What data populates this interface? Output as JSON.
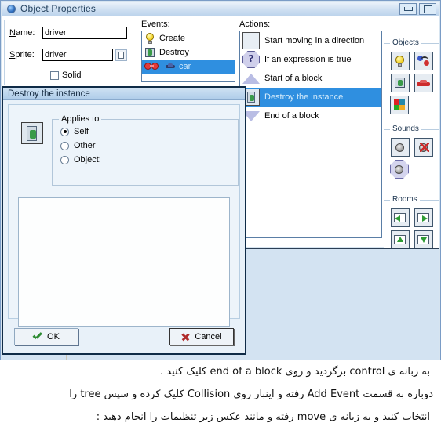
{
  "window": {
    "title": "Object Properties",
    "icon": "app-icon",
    "buttons": [
      {
        "name": "minimize-button",
        "glyph": "minimize-icon"
      },
      {
        "name": "maximize-button",
        "glyph": "maximize-icon"
      }
    ]
  },
  "properties": {
    "name_label": "Name:",
    "name_value": "driver",
    "sprite_label": "Sprite:",
    "sprite_value": "driver",
    "sprite_picker": "sprite-menu-icon",
    "solid_label": "Solid",
    "solid_checked": false
  },
  "events": {
    "caption": "Events:",
    "items": [
      {
        "label": "Create",
        "icon": "lightbulb-icon",
        "selected": false
      },
      {
        "label": "Destroy",
        "icon": "shield-icon",
        "selected": false
      },
      {
        "label": "car",
        "icon": "collision-icon",
        "selected": true
      }
    ]
  },
  "actions": {
    "caption": "Actions:",
    "items": [
      {
        "label": "Start moving in a direction",
        "icon": "move-direction-icon",
        "selected": false
      },
      {
        "label": "If an expression is true",
        "icon": "question-icon",
        "selected": false
      },
      {
        "label": "Start of a block",
        "icon": "block-start-icon",
        "selected": false
      },
      {
        "label": "Destroy the instance",
        "icon": "destroy-instance-icon",
        "selected": true
      },
      {
        "label": "End of a block",
        "icon": "block-end-icon",
        "selected": false
      }
    ]
  },
  "toolbar": {
    "groups": [
      {
        "caption": "Objects",
        "buttons": [
          {
            "name": "create-event-button",
            "icon": "lightbulb-icon"
          },
          {
            "name": "add-object-event-button",
            "icon": "objects-icon"
          },
          {
            "name": "destroy-event-button",
            "icon": "shield-icon"
          },
          {
            "name": "car-object-button",
            "icon": "car-icon"
          },
          {
            "name": "draw-event-button",
            "icon": "palette-icon"
          }
        ]
      },
      {
        "caption": "Sounds",
        "buttons": [
          {
            "name": "play-sound-button",
            "icon": "speaker-icon"
          },
          {
            "name": "stop-sound-button",
            "icon": "speaker-mute-icon"
          },
          {
            "name": "check-sound-button",
            "icon": "speaker-check-icon"
          }
        ]
      },
      {
        "caption": "Rooms",
        "buttons": [
          {
            "name": "previous-room-button",
            "icon": "room-left-icon"
          },
          {
            "name": "next-room-button",
            "icon": "room-right-icon"
          },
          {
            "name": "restart-room-button",
            "icon": "room-up-icon"
          },
          {
            "name": "goto-room-button",
            "icon": "room-down-icon"
          },
          {
            "name": "check-previous-room-button",
            "icon": "room-left-check-icon"
          },
          {
            "name": "check-next-room-button",
            "icon": "room-right-check-icon"
          }
        ]
      }
    ]
  },
  "dialog": {
    "title": "Destroy the instance",
    "action_icon": "destroy-instance-icon",
    "applies_to": {
      "caption": "Applies to",
      "options": [
        {
          "label": "Self",
          "selected": true
        },
        {
          "label": "Other",
          "selected": false
        },
        {
          "label": "Object:",
          "selected": false
        }
      ]
    },
    "ok_label": "OK",
    "cancel_label": "Cancel"
  },
  "caption_text": {
    "line1": "به زبانه ی control برگردید و روی end of a block کلیک کنید .",
    "line2": "دوباره به قسمت Add Event رفته و اینبار روی Collision کلیک کرده و سپس tree را",
    "line3": "انتخاب کنید و به زبانه ی move رفته و مانند عکس زیر تنظیمات را انجام دهید :"
  },
  "colors": {
    "selection": "#2f8fe0",
    "window_chrome": "#d6e4f0",
    "dialog_bg": "#e8f1f9"
  }
}
